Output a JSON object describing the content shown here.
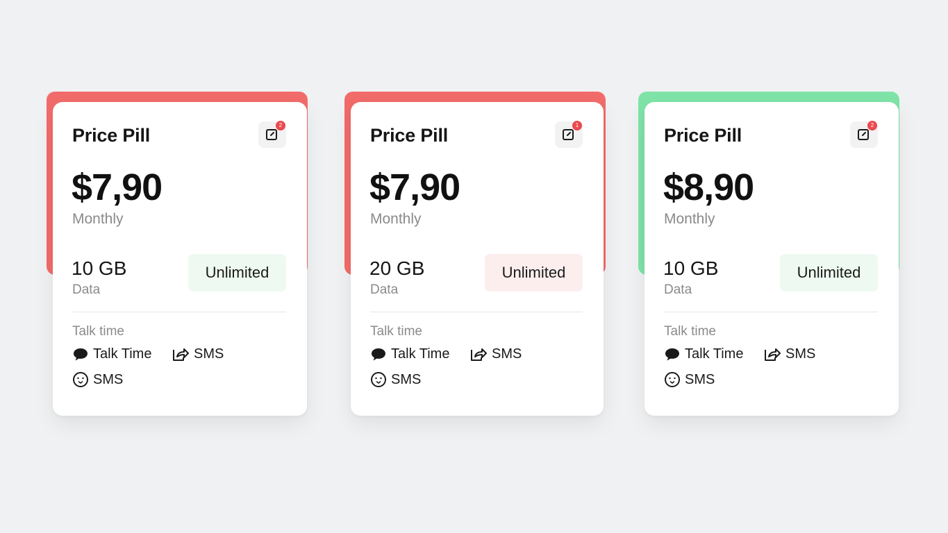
{
  "colors": {
    "accent_red": "#f26b6b",
    "accent_green": "#7fe3a8",
    "pill_green": "#eefaf1",
    "pill_red": "#fdeeee",
    "badge": "#ea4a4f"
  },
  "cards": [
    {
      "title": "Price Pill",
      "notification_count": "2",
      "price": "$7,90",
      "period": "Monthly",
      "data_amount": "10 GB",
      "data_label": "Data",
      "pill_label": "Unlimited",
      "section_label": "Talk time",
      "features": [
        {
          "label": "Talk Time",
          "icon": "speech-bubble-icon"
        },
        {
          "label": "SMS",
          "icon": "share-icon"
        },
        {
          "label": "SMS",
          "icon": "smiley-icon"
        }
      ]
    },
    {
      "title": "Price Pill",
      "notification_count": "1",
      "price": "$7,90",
      "period": "Monthly",
      "data_amount": "20 GB",
      "data_label": "Data",
      "pill_label": "Unlimited",
      "section_label": "Talk time",
      "features": [
        {
          "label": "Talk Time",
          "icon": "speech-bubble-icon"
        },
        {
          "label": "SMS",
          "icon": "share-icon"
        },
        {
          "label": "SMS",
          "icon": "smiley-icon"
        }
      ]
    },
    {
      "title": "Price Pill",
      "notification_count": "2",
      "price": "$8,90",
      "period": "Monthly",
      "data_amount": "10 GB",
      "data_label": "Data",
      "pill_label": "Unlimited",
      "section_label": "Talk time",
      "features": [
        {
          "label": "Talk Time",
          "icon": "speech-bubble-icon"
        },
        {
          "label": "SMS",
          "icon": "share-icon"
        },
        {
          "label": "SMS",
          "icon": "smiley-icon"
        }
      ]
    }
  ]
}
